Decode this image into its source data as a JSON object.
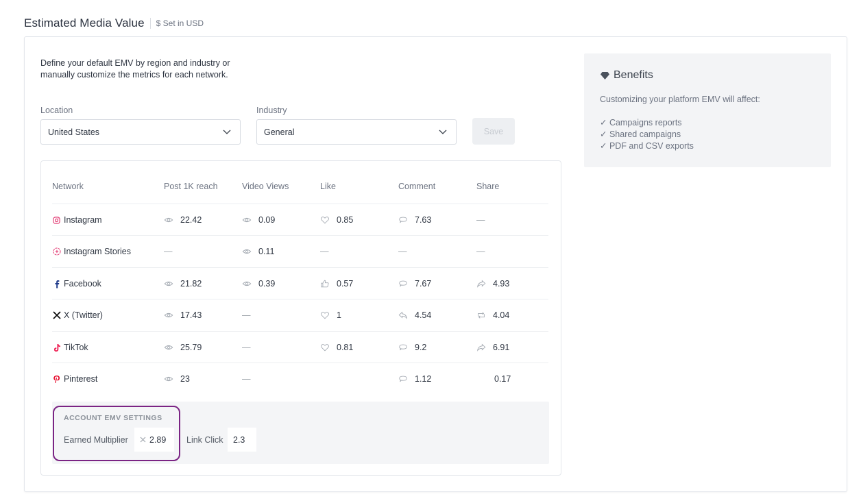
{
  "header": {
    "title": "Estimated Media Value",
    "currency_note": "$ Set in USD"
  },
  "intro": "Define your default EMV by region and industry or manually customize the metrics for each network.",
  "location": {
    "label": "Location",
    "value": "United States"
  },
  "industry": {
    "label": "Industry",
    "value": "General"
  },
  "save_label": "Save",
  "table": {
    "headers": [
      "Network",
      "Post 1K reach",
      "Video Views",
      "Like",
      "Comment",
      "Share"
    ],
    "rows": [
      {
        "network": "Instagram",
        "network_icon": "instagram-icon",
        "reach": "22.42",
        "video": "0.09",
        "like": "0.85",
        "comment": "7.63",
        "share": "—"
      },
      {
        "network": "Instagram Stories",
        "network_icon": "stories-icon",
        "reach": "—",
        "video": "0.11",
        "like": "—",
        "comment": "—",
        "share": "—"
      },
      {
        "network": "Facebook",
        "network_icon": "facebook-icon",
        "reach": "21.82",
        "video": "0.39",
        "like": "0.57",
        "comment": "7.67",
        "share": "4.93"
      },
      {
        "network": "X (Twitter)",
        "network_icon": "x-icon",
        "reach": "17.43",
        "video": "—",
        "like": "1",
        "comment": "4.54",
        "share": "4.04"
      },
      {
        "network": "TikTok",
        "network_icon": "tiktok-icon",
        "reach": "25.79",
        "video": "—",
        "like": "0.81",
        "comment": "9.2",
        "share": "6.91"
      },
      {
        "network": "Pinterest",
        "network_icon": "pinterest-icon",
        "reach": "23",
        "video": "—",
        "like": "",
        "comment": "1.12",
        "share": "0.17"
      }
    ]
  },
  "account_settings": {
    "title": "ACCOUNT EMV SETTINGS",
    "earned_multiplier_label": "Earned Multiplier",
    "earned_multiplier_value": "2.89",
    "link_click_label": "Link Click",
    "link_click_value": "2.3"
  },
  "benefits": {
    "title": "Benefits",
    "subtitle": "Customizing your platform EMV will affect:",
    "items": [
      "Campaigns reports",
      "Shared campaigns",
      "PDF and CSV exports"
    ]
  },
  "colors": {
    "accent_purple": "#7b2484",
    "instagram": "#e1306c",
    "tiktok": "#ee1d52",
    "pinterest": "#e60023",
    "facebook": "#1f3a8a"
  }
}
